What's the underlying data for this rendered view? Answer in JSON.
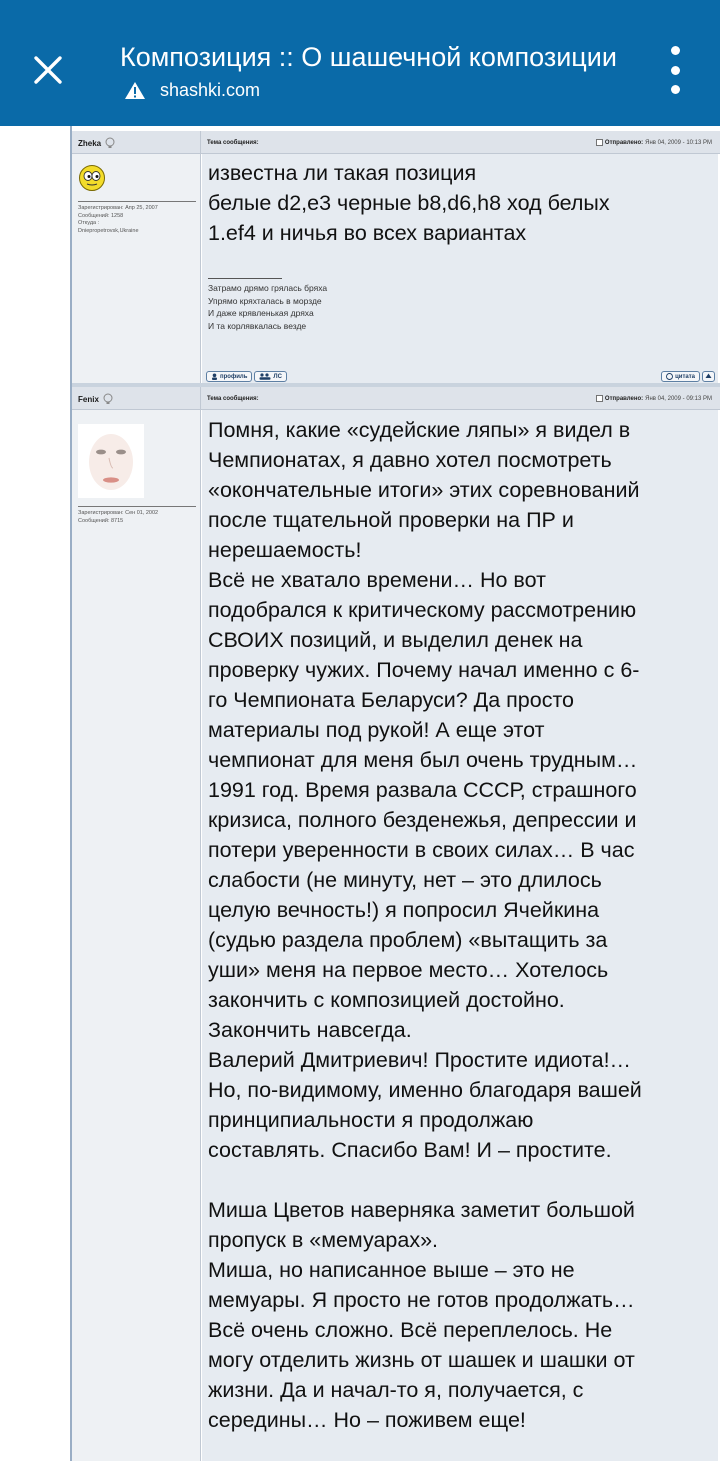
{
  "browser": {
    "title": "Композиция :: О шашечной композиции",
    "url": "shashki.com",
    "security_icon": "warning-icon",
    "close_icon": "close-icon",
    "menu_icon": "more-vert-icon"
  },
  "labels": {
    "subject": "Тема сообщения:",
    "posted": "Отправлено:",
    "profile_btn": "профиль",
    "pm_btn": "ЛС",
    "quote_btn": "цитата"
  },
  "colors": {
    "toolbar": "#0a6aa8",
    "post_bg": "#e6ebf1",
    "header_bg": "#dee3ea"
  },
  "posts": [
    {
      "author": "Zheka",
      "posted_date": "Янв 04, 2009 - 10:13 PM",
      "reg": "Зарегистрирован: Апр 25, 2007",
      "messages": "Сообщений: 1258",
      "from_label": "Откуда :",
      "location": "Dniepropetrovsk,Ukraine",
      "avatar_icon": "smiley-avatar-icon",
      "body": [
        "известна ли такая позиция",
        "белые d2,e3 черные b8,d6,h8 ход белых",
        "1.ef4 и ничья во всех вариантах"
      ],
      "signature_rule": "_________________",
      "signature": [
        "Затрамо дрямо грялась бряха",
        "Упрямо кряхталась в морзде",
        "И даже крявленькая дряха",
        "И та корлявкалась везде"
      ]
    },
    {
      "author": "Fenix",
      "posted_date": "Янв 04, 2009 - 09:13 PM",
      "reg": "Зарегистрирован: Сен 01, 2002",
      "messages": "Сообщений: 8715",
      "avatar_icon": "face-photo-avatar",
      "body": [
        "Помня, какие «судейские ляпы» я видел в",
        "Чемпионатах, я давно хотел посмотреть",
        "«окончательные итоги» этих соревнований",
        "после тщательной проверки на ПР и",
        "нерешаемость!",
        "Всё не хватало времени… Но вот",
        "подобрался к критическому рассмотрению",
        "СВОИХ позиций, и выделил денек на",
        "проверку чужих. Почему начал именно с 6-",
        "го Чемпионата Беларуси? Да просто",
        "материалы под рукой! А еще этот",
        "чемпионат для меня был очень трудным…",
        "1991 год. Время развала СССР, страшного",
        "кризиса, полного безденежья, депрессии и",
        "потери уверенности в своих силах… В час",
        "слабости (не минуту, нет – это длилось",
        "целую вечность!) я попросил Ячейкина",
        "(судью раздела проблем) «вытащить за",
        "уши» меня на первое место… Хотелось",
        "закончить с композицией достойно.",
        "Закончить навсегда.",
        "Валерий Дмитриевич! Простите идиота!…",
        "Но, по-видимому, именно благодаря вашей",
        "принципиальности я продолжаю",
        "составлять. Спасибо Вам! И – простите.",
        "",
        "Миша Цветов наверняка заметит большой",
        "пропуск в «мемуарах».",
        "Миша, но написанное выше – это не",
        "мемуары. Я просто не готов продолжать…",
        "Всё очень сложно. Всё переплелось. Не",
        "могу отделить жизнь от шашек и шашки от",
        "жизни. Да и начал-то я, получается, с",
        "середины… Но – поживем еще!"
      ]
    }
  ]
}
